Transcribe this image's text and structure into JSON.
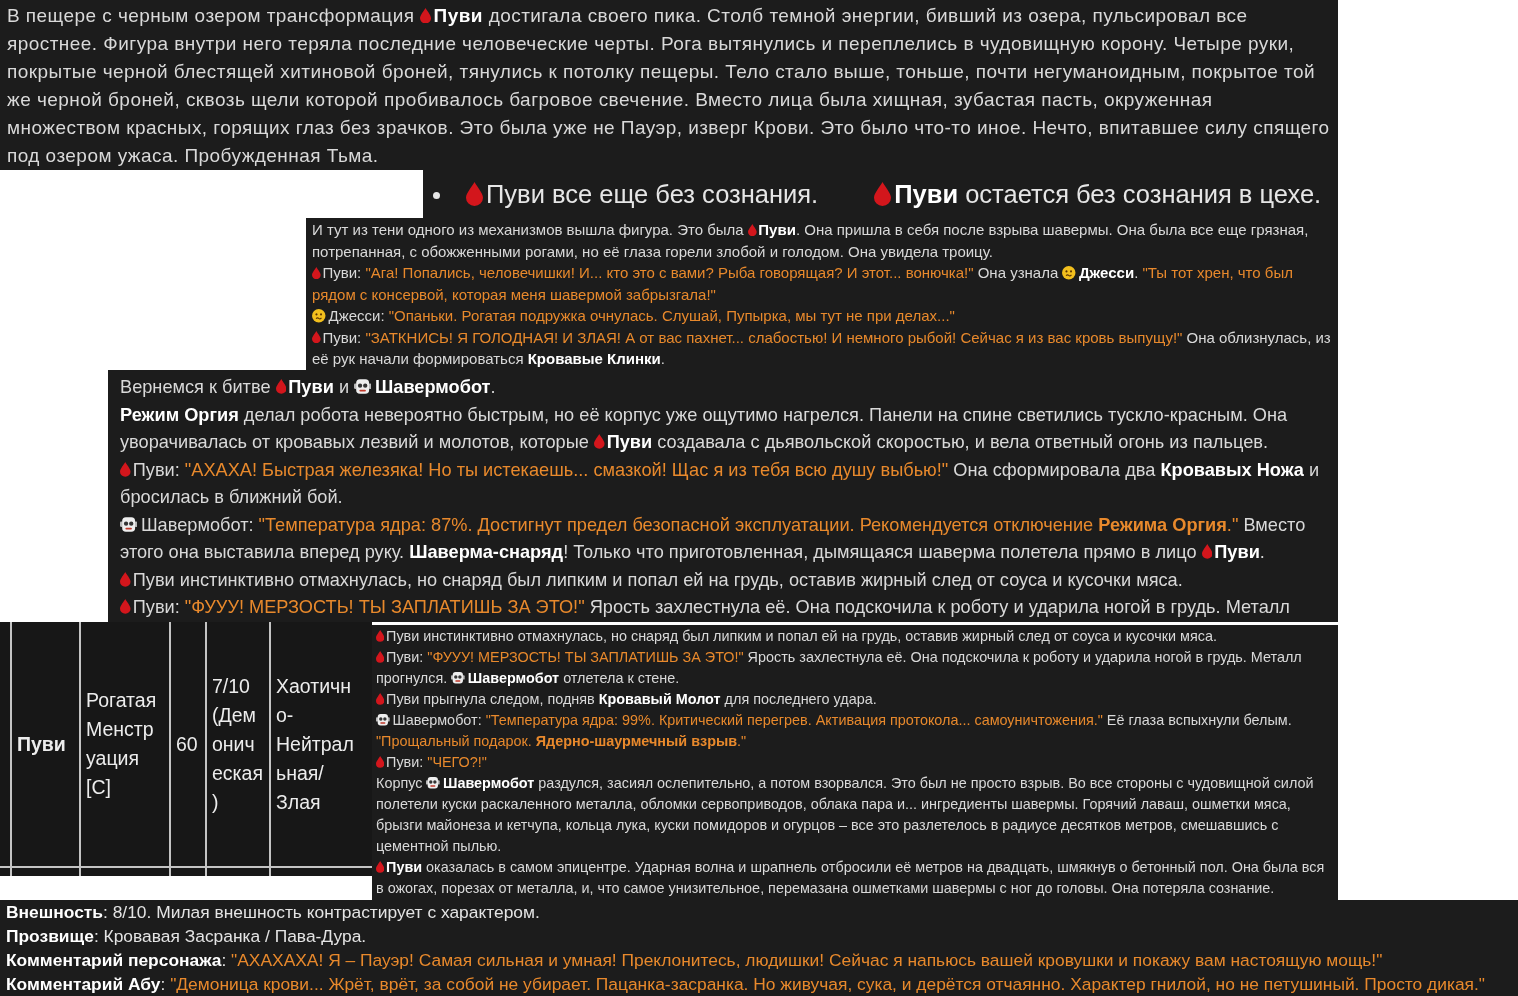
{
  "cave_scene": {
    "paragraphs": [
      [
        {
          "kind": "text",
          "text": "В пещере с черным озером трансформация "
        },
        {
          "kind": "blood"
        },
        {
          "kind": "text",
          "text": "**Пуви** достигала своего пика. Столб темной энергии, бивший из озера, пульсировал все яростнее. Фигура внутри него теряла последние человеческие черты. Рога вытянулись и переплелись в чудовищную корону. Четыре руки, покрытые черной блестящей хитиновой броней, тянулись к потолку пещеры. Тело стало выше, тоньше, почти негуманоидным, покрытое той же черной броней, сквозь щели которой пробивалось багровое свечение. Вместо лица была хищная, зубастая пасть, окруженная множеством красных, горящих глаз без зрачков. Это была уже не Пауэр, изверг Крови. Это было что-то иное. Нечто, впитавшее силу спящего под озером ужаса. Пробужденная Тьма."
        }
      ]
    ]
  },
  "status_headings": {
    "headings": [
      [
        {
          "kind": "bullet"
        },
        {
          "kind": "blood"
        },
        {
          "kind": "text",
          "text": "Пуви все еще без сознания."
        }
      ],
      [
        {
          "kind": "blood"
        },
        {
          "kind": "text",
          "text": "**Пуви** остается без сознания в цехе."
        }
      ]
    ]
  },
  "factory_scene": {
    "paragraphs": [
      [
        {
          "kind": "text",
          "text": "И тут из тени одного из механизмов вышла фигура. Это была "
        },
        {
          "kind": "blood"
        },
        {
          "kind": "text",
          "text": "**Пуви**. Она пришла в себя после взрыва шавермы. Она была все еще грязная, потрепанная, с обожженными рогами, но её глаза горели злобой и голодом. Она увидела троицу."
        }
      ],
      [
        {
          "kind": "blood"
        },
        {
          "kind": "text",
          "text": "Пуви: "
        },
        {
          "kind": "quote",
          "text": "\"Ага! Попались, человечишки! И... кто это с вами? Рыба говорящая? И этот... вонючка!\""
        },
        {
          "kind": "text",
          "text": " Она узнала "
        },
        {
          "kind": "smiley"
        },
        {
          "kind": "text",
          "text": "**Джесси**. "
        },
        {
          "kind": "quote",
          "text": "\"Ты тот хрен, что был рядом с консервой, которая меня шавермой забрызгала!\""
        }
      ],
      [
        {
          "kind": "smiley"
        },
        {
          "kind": "text",
          "text": "Джесси: "
        },
        {
          "kind": "quote",
          "text": "\"Опаньки. Рогатая подружка очнулась. Слушай, Пупырка, мы тут не при делах...\""
        }
      ],
      [
        {
          "kind": "blood"
        },
        {
          "kind": "text",
          "text": "Пуви: "
        },
        {
          "kind": "quote",
          "text": "\"ЗАТКНИСЬ! Я ГОЛОДНАЯ! И ЗЛАЯ! А от вас пахнет... слабостью! И немного рыбой! Сейчас я из вас кровь выпущу!\""
        },
        {
          "kind": "text",
          "text": " Она облизнулась, из её рук начали формироваться **Кровавые Клинки**."
        }
      ]
    ]
  },
  "battle_scene": {
    "paragraphs": [
      [
        {
          "kind": "text",
          "text": "Вернемся к битве "
        },
        {
          "kind": "blood"
        },
        {
          "kind": "text",
          "text": "**Пуви** и "
        },
        {
          "kind": "robot"
        },
        {
          "kind": "text",
          "text": "**Шавермобот**."
        }
      ],
      [
        {
          "kind": "text",
          "text": "**Режим Оргия** делал робота невероятно быстрым, но её корпус уже ощутимо нагрелся. Панели на спине светились тускло-красным. Она уворачивалась от кровавых лезвий и молотов, которые "
        },
        {
          "kind": "blood"
        },
        {
          "kind": "text",
          "text": "**Пуви** создавала с дьявольской скоростью, и вела ответный огонь из пальцев."
        }
      ],
      [
        {
          "kind": "blood"
        },
        {
          "kind": "text",
          "text": "Пуви: "
        },
        {
          "kind": "quote",
          "text": "\"АХАХА! Быстрая железяка! Но ты истекаешь... смазкой! Щас я из тебя всю душу выбью!\""
        },
        {
          "kind": "text",
          "text": " Она сформировала два **Кровавых Ножа** и бросилась в ближний бой."
        }
      ],
      [
        {
          "kind": "robot"
        },
        {
          "kind": "text",
          "text": "Шавермобот: "
        },
        {
          "kind": "quote",
          "text": "\"Температура ядра: 87%. Достигнут предел безопасной эксплуатации. Рекомендуется отключение **Режима Оргия**.\""
        },
        {
          "kind": "text",
          "text": " Вместо этого она выставила вперед руку. **Шаверма-снаряд**! Только что приготовленная, дымящаяся шаверма полетела прямо в лицо "
        },
        {
          "kind": "blood"
        },
        {
          "kind": "text",
          "text": "**Пуви**."
        }
      ],
      [
        {
          "kind": "blood"
        },
        {
          "kind": "text",
          "text": "Пуви инстинктивно отмахнулась, но снаряд был липким и попал ей на грудь, оставив жирный след от соуса и кусочки мяса."
        }
      ],
      [
        {
          "kind": "blood"
        },
        {
          "kind": "text",
          "text": "Пуви: "
        },
        {
          "kind": "quote",
          "text": "\"ФУУУ! МЕРЗОСТЬ! ТЫ ЗАПЛАТИШЬ ЗА ЭТО!\""
        },
        {
          "kind": "text",
          "text": " Ярость захлестнула её. Она подскочила к роботу и ударила ногой в грудь. Металл"
        }
      ]
    ]
  },
  "character_table": {
    "cells": [
      "Пуви",
      "Рогатая Менструация [C]",
      "60",
      "7/10 (Демоническая)",
      "Хаотично-Нейтральная/Злая"
    ]
  },
  "explosion_scene": {
    "paragraphs": [
      [
        {
          "kind": "blood"
        },
        {
          "kind": "text",
          "text": "Пуви инстинктивно отмахнулась, но снаряд был липким и попал ей на грудь, оставив жирный след от соуса и кусочки мяса."
        }
      ],
      [
        {
          "kind": "blood"
        },
        {
          "kind": "text",
          "text": "Пуви: "
        },
        {
          "kind": "quote",
          "text": "\"ФУУУ! МЕРЗОСТЬ! ТЫ ЗАПЛАТИШЬ ЗА ЭТО!\""
        },
        {
          "kind": "text",
          "text": " Ярость захлестнула её. Она подскочила к роботу и ударила ногой в грудь. Металл прогнулся. "
        },
        {
          "kind": "robot"
        },
        {
          "kind": "text",
          "text": "**Шавермобот** отлетела к стене."
        }
      ],
      [
        {
          "kind": "blood"
        },
        {
          "kind": "text",
          "text": "Пуви прыгнула следом, подняв **Кровавый Молот** для последнего удара."
        }
      ],
      [
        {
          "kind": "robot"
        },
        {
          "kind": "text",
          "text": "Шавермобот: "
        },
        {
          "kind": "quote",
          "text": "\"Температура ядра: 99%. Критический перегрев. Активация протокола... самоуничтожения.\""
        },
        {
          "kind": "text",
          "text": " Её глаза вспыхнули белым. "
        },
        {
          "kind": "quote",
          "text": "\"Прощальный подарок. **Ядерно-шаурмечный взрыв**.\""
        }
      ],
      [
        {
          "kind": "blood"
        },
        {
          "kind": "text",
          "text": "Пуви: "
        },
        {
          "kind": "quote",
          "text": "\"ЧЕГО?!\""
        }
      ],
      [
        {
          "kind": "text",
          "text": "Корпус "
        },
        {
          "kind": "robot"
        },
        {
          "kind": "text",
          "text": "**Шавермобот** раздулся, засиял ослепительно, а потом взорвался. Это был не просто взрыв. Во все стороны с чудовищной силой полетели куски раскаленного металла, обломки сервоприводов, облака пара и... ингредиенты шавермы. Горячий лаваш, ошметки мяса, брызги майонеза и кетчупа, кольца лука, куски помидоров и огурцов – все это разлетелось в радиусе десятков метров, смешавшись с цементной пылью."
        }
      ],
      [
        {
          "kind": "blood"
        },
        {
          "kind": "text",
          "text": "**Пуви** оказалась в самом эпицентре. Ударная волна и шрапнель отбросили её метров на двадцать, шмякнув о бетонный пол. Она была вся в ожогах, порезах от металла, и, что самое унизительное, перемазана ошметками шавермы с ног до головы. Она потеряла сознание."
        }
      ]
    ]
  },
  "character_notes": {
    "paragraphs": [
      [
        {
          "kind": "text",
          "text": "**Внешность**: 8/10. Милая внешность контрастирует с характером."
        }
      ],
      [
        {
          "kind": "text",
          "text": "**Прозвище**: Кровавая Засранка / Пава-Дура."
        }
      ],
      [
        {
          "kind": "text",
          "text": "**Комментарий персонажа**: "
        },
        {
          "kind": "quote",
          "text": "\"АХАХАХА! Я – Пауэр! Самая сильная и умная! Преклонитесь, людишки! Сейчас я напьюсь вашей кровушки и покажу вам настоящую мощь!\""
        }
      ],
      [
        {
          "kind": "text",
          "text": "**Комментарий Абу**: "
        },
        {
          "kind": "quote",
          "text": "\"Демоница крови... Жрёт, врёт, за собой не убирает. Пацанка-засранка. Но живучая, сука, и дерётся отчаянно. Характер гнилой, но не петушиный. Просто дикая.\""
        }
      ]
    ]
  }
}
